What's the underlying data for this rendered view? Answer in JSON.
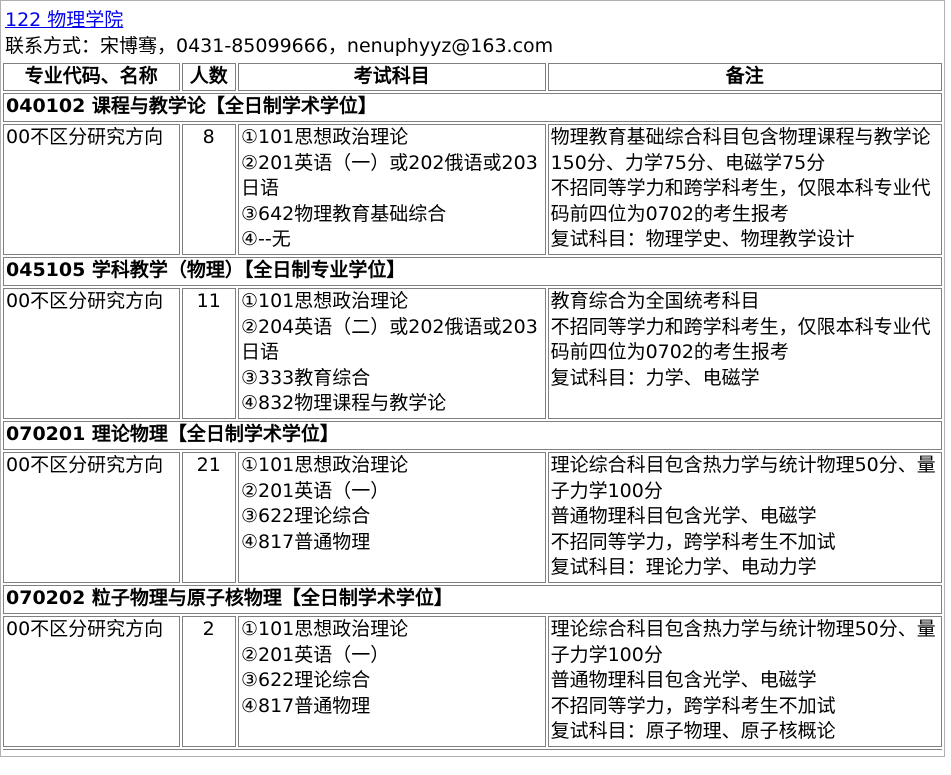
{
  "header": {
    "link": "122 物理学院",
    "contact": "联系方式：宋博骞，0431-85099666，nenuphyyz@163.com"
  },
  "columns": {
    "major": "专业代码、名称",
    "count": "人数",
    "subjects": "考试科目",
    "notes": "备注"
  },
  "sections": [
    {
      "title": "040102 课程与教学论【全日制学术学位】",
      "direction": "00不区分研究方向",
      "count": "8",
      "subjects": [
        "①101思想政治理论",
        "②201英语（一）或202俄语或203日语",
        "③642物理教育基础综合",
        "④--无"
      ],
      "notes": [
        "物理教育基础综合科目包含物理课程与教学论150分、力学75分、电磁学75分",
        "不招同等学力和跨学科考生，仅限本科专业代码前四位为0702的考生报考",
        "复试科目：物理学史、物理教学设计"
      ]
    },
    {
      "title": "045105 学科教学（物理）【全日制专业学位】",
      "direction": "00不区分研究方向",
      "count": "11",
      "subjects": [
        "①101思想政治理论",
        "②204英语（二）或202俄语或203日语",
        "③333教育综合",
        "④832物理课程与教学论"
      ],
      "notes": [
        "教育综合为全国统考科目",
        "不招同等学力和跨学科考生，仅限本科专业代码前四位为0702的考生报考",
        "复试科目：力学、电磁学"
      ]
    },
    {
      "title": "070201 理论物理【全日制学术学位】",
      "direction": "00不区分研究方向",
      "count": "21",
      "subjects": [
        "①101思想政治理论",
        "②201英语（一）",
        "③622理论综合",
        "④817普通物理"
      ],
      "notes": [
        "理论综合科目包含热力学与统计物理50分、量子力学100分",
        "普通物理科目包含光学、电磁学",
        "不招同等学力，跨学科考生不加试",
        "复试科目：理论力学、电动力学"
      ]
    },
    {
      "title": "070202 粒子物理与原子核物理【全日制学术学位】",
      "direction": "00不区分研究方向",
      "count": "2",
      "subjects": [
        "①101思想政治理论",
        "②201英语（一）",
        "③622理论综合",
        "④817普通物理"
      ],
      "notes": [
        "理论综合科目包含热力学与统计物理50分、量子力学100分",
        "普通物理科目包含光学、电磁学",
        "不招同等学力，跨学科考生不加试",
        "复试科目：原子物理、原子核概论"
      ]
    }
  ]
}
